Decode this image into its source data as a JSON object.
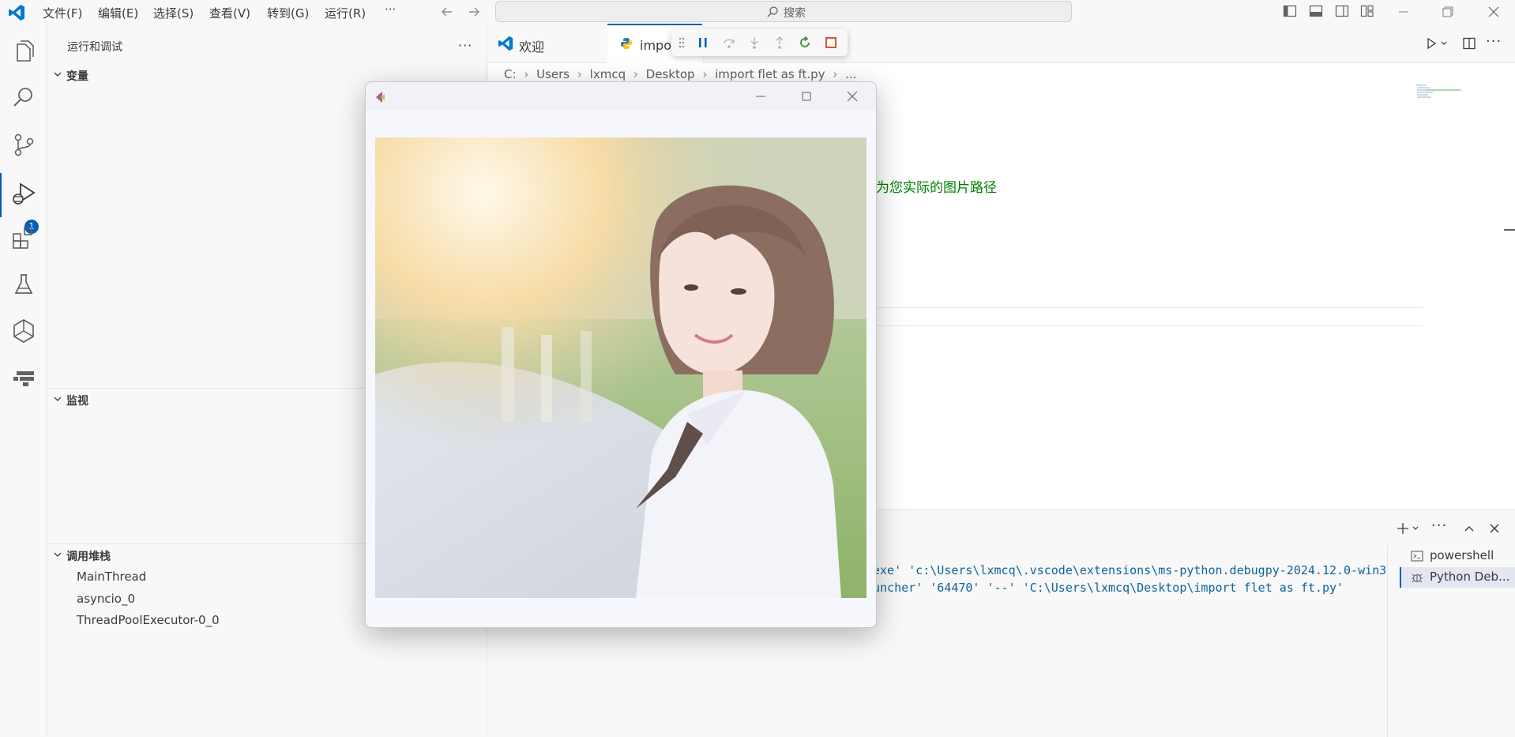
{
  "menu": {
    "file": "文件(F)",
    "edit": "编辑(E)",
    "select": "选择(S)",
    "view": "查看(V)",
    "goto": "转到(G)",
    "run": "运行(R)",
    "more": "···"
  },
  "search": {
    "label": "搜索"
  },
  "activity": {
    "debug_badge": "1"
  },
  "sidebar": {
    "title": "运行和调试",
    "sections": {
      "variables": "变量",
      "watch": "监视",
      "call_stack": "调用堆栈"
    },
    "threads": [
      "MainThread",
      "asyncio_0",
      "ThreadPoolExecutor-0_0"
    ]
  },
  "tabs": [
    {
      "label": "欢迎"
    },
    {
      "label": "impor"
    }
  ],
  "breadcrumb": {
    "drive": "C:",
    "users": "Users",
    "user": "lxmcq",
    "desktop": "Desktop",
    "file": "import flet as ft.py",
    "more": "..."
  },
  "editor": {
    "comment_fragment": "为您实际的图片路径"
  },
  "terminal": {
    "line1": "exe' 'c:\\Users\\lxmcq\\.vscode\\extensions\\ms-python.debugpy-2024.12.0-win3",
    "line2": "uncher' '64470' '--' 'C:\\Users\\lxmcq\\Desktop\\import flet as ft.py'",
    "sessions": [
      "powershell",
      "Python Deb..."
    ]
  },
  "colors": {
    "accent": "#005fb8",
    "restart_green": "#388a34",
    "stop_red": "#c72e0f",
    "comment_green": "#008000",
    "terminal_blue": "#0e639c"
  }
}
